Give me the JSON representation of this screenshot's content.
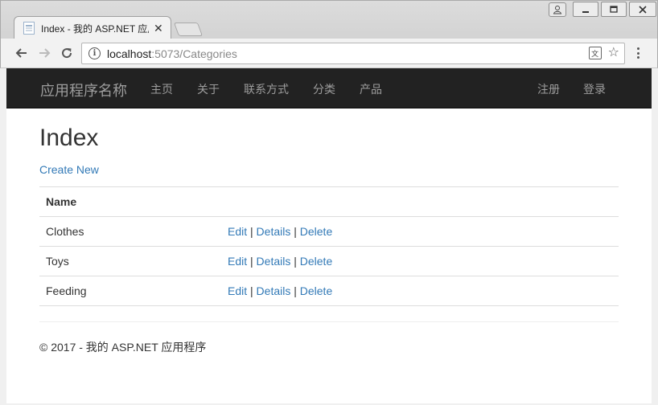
{
  "browser": {
    "tab_title": "Index - 我的 ASP.NET 应用程序",
    "url_host": "localhost",
    "url_path": ":5073/Categories",
    "info_icon": "i"
  },
  "navbar": {
    "brand": "应用程序名称",
    "links": [
      "主页",
      "关于",
      "联系方式",
      "分类",
      "产品"
    ],
    "right_links": [
      "注册",
      "登录"
    ]
  },
  "page": {
    "title": "Index",
    "create_link": "Create New",
    "table": {
      "header": "Name",
      "rows": [
        {
          "name": "Clothes",
          "edit": "Edit",
          "details": "Details",
          "delete": "Delete"
        },
        {
          "name": "Toys",
          "edit": "Edit",
          "details": "Details",
          "delete": "Delete"
        },
        {
          "name": "Feeding",
          "edit": "Edit",
          "details": "Details",
          "delete": "Delete"
        }
      ],
      "separator": "|"
    },
    "footer": "© 2017 - 我的 ASP.NET 应用程序"
  },
  "colors": {
    "navbar_bg": "#222222",
    "nav_text": "#9d9d9d",
    "link": "#337ab7"
  }
}
